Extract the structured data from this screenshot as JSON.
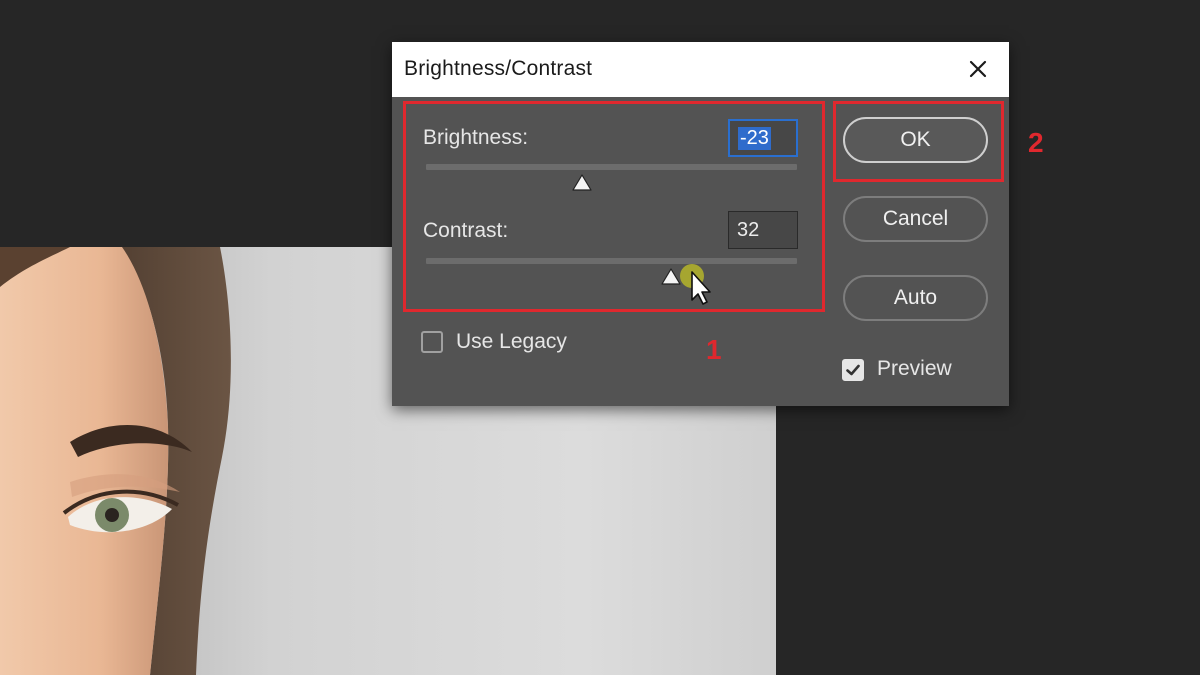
{
  "dialog": {
    "title": "Brightness/Contrast",
    "brightness": {
      "label": "Brightness:",
      "value": "-23",
      "slider_fraction": 0.42
    },
    "contrast": {
      "label": "Contrast:",
      "value": "32",
      "slider_fraction": 0.66
    },
    "use_legacy": {
      "label": "Use Legacy",
      "checked": false
    },
    "preview": {
      "label": "Preview",
      "checked": true
    },
    "buttons": {
      "ok": "OK",
      "cancel": "Cancel",
      "auto": "Auto"
    }
  },
  "annotations": {
    "marker_1": "1",
    "marker_2": "2",
    "color": "#e0282e"
  },
  "icons": {
    "close": "close-icon",
    "cursor": "mouse-pointer-icon",
    "checkmark": "checkmark-icon"
  },
  "colors": {
    "dialog_bg": "#535353",
    "workspace_bg": "#262626",
    "selection": "#2f6ccc"
  }
}
